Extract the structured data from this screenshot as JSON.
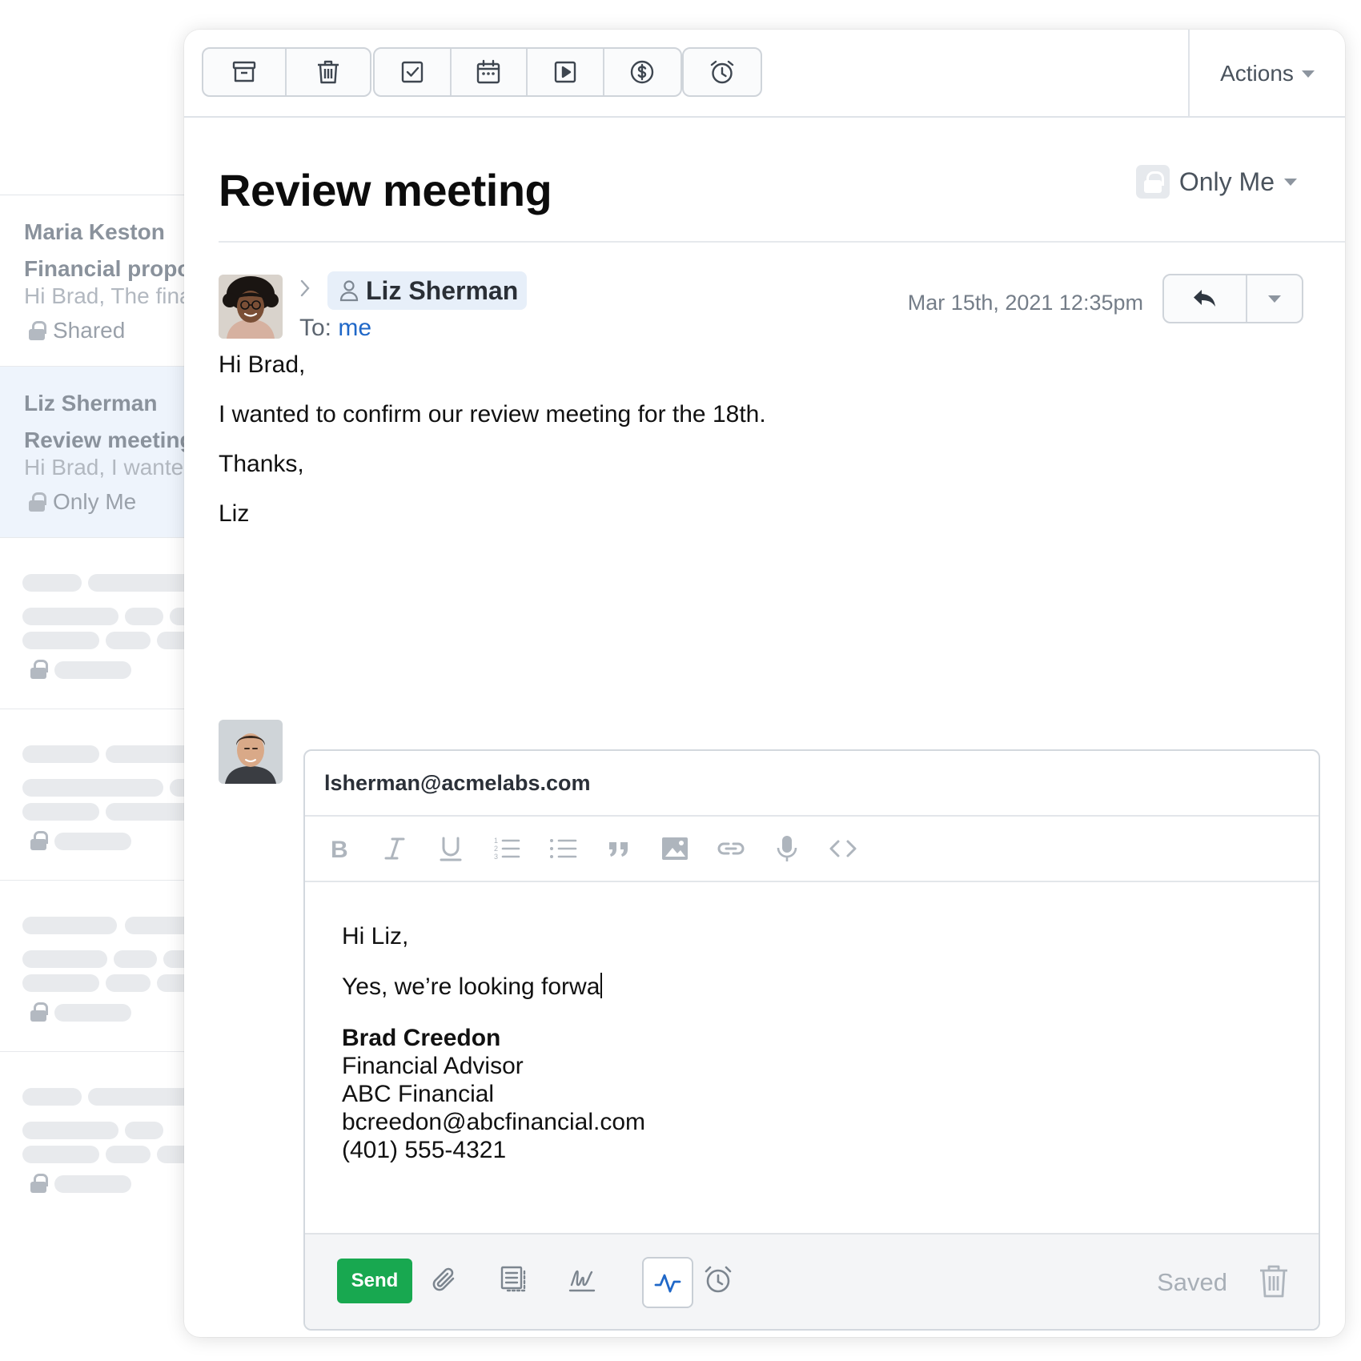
{
  "list": {
    "items": [
      {
        "sender": "Maria Keston",
        "subject": "Financial proposal",
        "snippet": "Hi Brad, The financial",
        "share": "Shared"
      },
      {
        "sender": "Liz Sherman",
        "subject": "Review meeting",
        "snippet": "Hi Brad, I wanted to confirm",
        "share": "Only Me"
      }
    ]
  },
  "toolbar": {
    "icons": [
      "archive-icon",
      "trash-icon",
      "task-icon",
      "calendar-icon",
      "play-icon",
      "dollar-icon",
      "alarm-icon"
    ],
    "actions_label": "Actions"
  },
  "email": {
    "title": "Review meeting",
    "privacy": "Only Me",
    "sender": "Liz Sherman",
    "to_label": "To:",
    "to_value": "me",
    "date": "Mar 15th, 2021 12:35pm",
    "body": [
      "Hi Brad,",
      "I wanted to confirm our review meeting for the 18th.",
      "Thanks,",
      "Liz"
    ]
  },
  "composer": {
    "to": "lsherman@acmelabs.com",
    "format_icons": [
      "bold-icon",
      "italic-icon",
      "underline-icon",
      "numbered-list-icon",
      "bullet-list-icon",
      "quote-icon",
      "image-icon",
      "link-icon",
      "microphone-icon",
      "code-icon"
    ],
    "greeting": "Hi Liz,",
    "draft": "Yes, we’re looking forwa",
    "signature": {
      "name": "Brad Creedon",
      "role": "Financial Advisor",
      "company": "ABC Financial",
      "email": "bcreedon@abcfinancial.com",
      "phone": "(401) 555-4321"
    },
    "send_label": "Send",
    "status": "Saved"
  },
  "colors": {
    "accent_blue": "#2068c8",
    "send_green": "#18a850",
    "selected_row": "#eef4fc",
    "chip_bg": "#e7eff9"
  }
}
